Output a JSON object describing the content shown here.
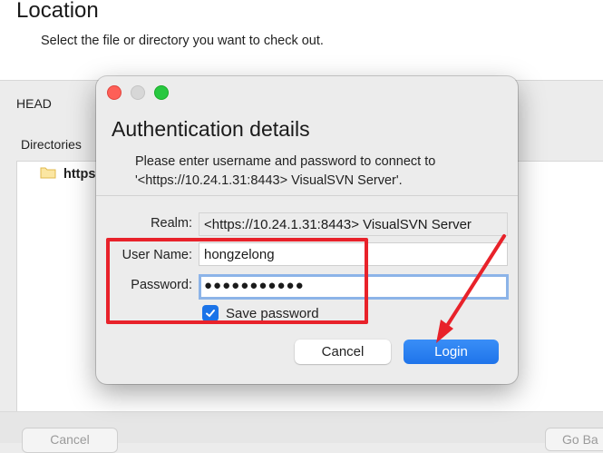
{
  "background": {
    "title": "Location",
    "subtitle": "Select the file or directory you want to check out.",
    "head_label": "HEAD",
    "directories_label": "Directories",
    "list_item": "https:",
    "cancel_button": "Cancel",
    "goback_button": "Go Ba"
  },
  "dialog": {
    "title": "Authentication details",
    "message_line1": "Please enter username and password to connect to",
    "message_line2": "'<https://10.24.1.31:8443> VisualSVN Server'.",
    "realm_label": "Realm:",
    "realm_value": "<https://10.24.1.31:8443> VisualSVN Server",
    "username_label": "User Name:",
    "username_value": "hongzelong",
    "password_label": "Password:",
    "password_value": "●●●●●●●●●●●",
    "save_password_label": "Save password",
    "save_password_checked": true,
    "cancel_label": "Cancel",
    "login_label": "Login"
  },
  "colors": {
    "annotation": "#e8222a",
    "accent": "#1f74ea",
    "traffic_close": "#fe5f57",
    "traffic_max": "#28c840"
  },
  "icons": [
    "folder-icon",
    "checkmark-icon",
    "annotation-arrow"
  ]
}
